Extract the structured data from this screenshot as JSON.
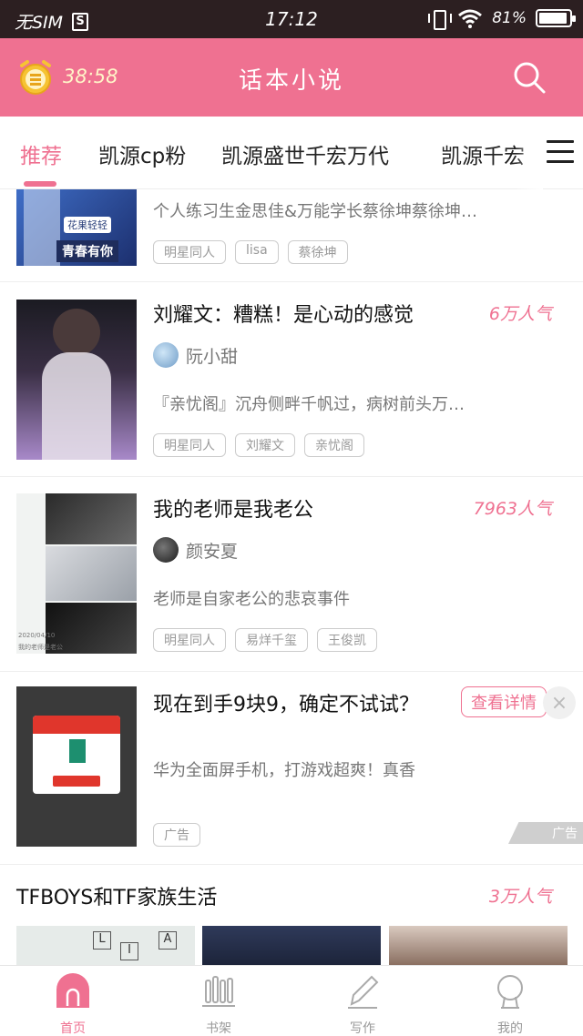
{
  "status_bar": {
    "sim": "无SIM",
    "sim_badge": "S",
    "time": "17:12",
    "battery": "81%"
  },
  "header": {
    "timer": "38:58",
    "title": "话本小说"
  },
  "tabs": [
    {
      "label": "推荐",
      "active": true
    },
    {
      "label": "凯源cp粉"
    },
    {
      "label": "凯源盛世千宏万代"
    },
    {
      "label": "凯源千宏"
    }
  ],
  "cards": [
    {
      "desc": "个人练习生金思佳&万能学长蔡徐坤蔡徐坤…",
      "tags": [
        "明星同人",
        "lisa",
        "蔡徐坤"
      ],
      "cover_text": [
        "花果轻轻",
        "青春有你"
      ]
    },
    {
      "title": "刘耀文：糟糕！是心动的感觉",
      "hot": "6万人气",
      "author": "阮小甜",
      "desc": "『亲忧阁』沉舟侧畔千帆过，病树前头万…",
      "tags": [
        "明星同人",
        "刘耀文",
        "亲忧阁"
      ]
    },
    {
      "title": "我的老师是我老公",
      "hot": "7963人气",
      "author": "颜安夏",
      "desc": "老师是自家老公的悲哀事件",
      "tags": [
        "明星同人",
        "易烊千玺",
        "王俊凯"
      ],
      "cover_caption": [
        "2020/04/10",
        "我的老师是老公"
      ]
    }
  ],
  "ad": {
    "title": "现在到手9块9，确定不试试？",
    "desc": "华为全面屏手机，打游戏超爽！真香",
    "cta": "查看详情",
    "close": "×",
    "tag": "广告",
    "badge": "广告"
  },
  "section": {
    "title": "TFBOYS和TF家族生活",
    "hot": "3万人气",
    "thumb_letters": [
      "L",
      "I",
      "A"
    ]
  },
  "bottom_nav": [
    {
      "label": "首页",
      "active": true
    },
    {
      "label": "书架"
    },
    {
      "label": "写作"
    },
    {
      "label": "我的"
    }
  ],
  "colors": {
    "accent": "#ef7191",
    "status_bar": "#2c1f21",
    "timer": "#fff5c8"
  }
}
